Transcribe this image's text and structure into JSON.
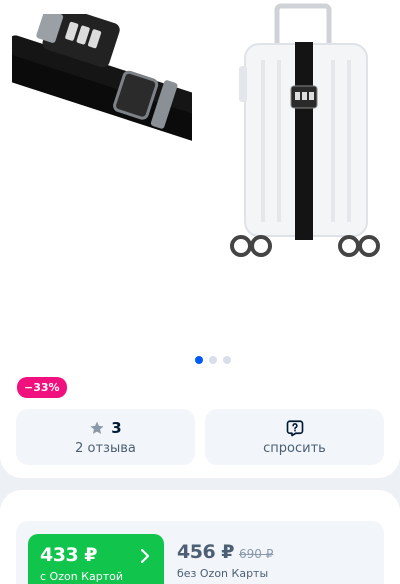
{
  "gallery": {
    "images": [
      "luggage-strap-with-lock",
      "suitcase-with-strap"
    ],
    "dots_total": 3,
    "dots_active": 1
  },
  "discount": {
    "label": "−33%"
  },
  "reviews": {
    "rating": "3",
    "count_label": "2 отзыва"
  },
  "questions": {
    "label": "спросить"
  },
  "price": {
    "ozon_card_price": "433 ₽",
    "ozon_card_caption": "с Ozon Картой",
    "regular_price": "456 ₽",
    "old_price": "690 ₽",
    "regular_caption": "без Ozon Карты"
  },
  "colors": {
    "accent": "#005bff",
    "discount": "#f1117e",
    "ozon_green": "#10c44c"
  }
}
